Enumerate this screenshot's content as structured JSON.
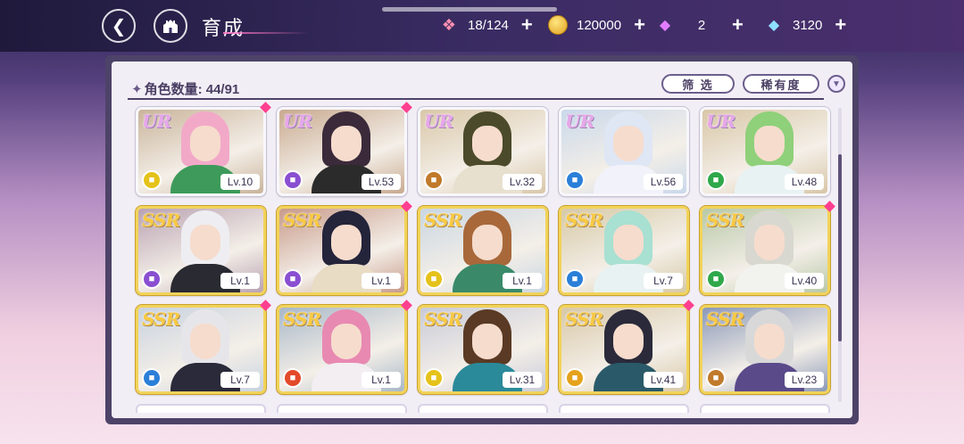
{
  "header": {
    "title": "育成",
    "back_icon": "back-arrow-icon",
    "home_icon": "castle-home-icon"
  },
  "resources": [
    {
      "icon": "candy-icon",
      "value": "18/124"
    },
    {
      "icon": "coin-icon",
      "value": "120000"
    },
    {
      "icon": "pink-diamond-icon",
      "value": "2"
    },
    {
      "icon": "blue-diamond-icon",
      "value": "3120"
    }
  ],
  "panel": {
    "count_label": "角色数量: 44/91",
    "filter_label": "筛 选",
    "rarity_label": "稀有度",
    "sort_icon": "chevron-down-icon"
  },
  "cards": [
    {
      "rarity": "UR",
      "level": "Lv.10",
      "attr_color": "#e5c21a",
      "hair": "#f2a9c8",
      "outfit": "#3d9a5a",
      "bg": "#c9b39a",
      "new": true
    },
    {
      "rarity": "UR",
      "level": "Lv.53",
      "attr_color": "#8a4fd1",
      "hair": "#3a2a3a",
      "outfit": "#2b2b2b",
      "bg": "#c8a98f",
      "new": true
    },
    {
      "rarity": "UR",
      "level": "Lv.32",
      "attr_color": "#c07a2a",
      "hair": "#4b4a2a",
      "outfit": "#e8e0cf",
      "bg": "#d9c7a8",
      "new": false
    },
    {
      "rarity": "UR",
      "level": "Lv.56",
      "attr_color": "#2a7fd8",
      "hair": "#dfe6f4",
      "outfit": "#f2f2fa",
      "bg": "#c9d8ea",
      "new": false
    },
    {
      "rarity": "UR",
      "level": "Lv.48",
      "attr_color": "#2fa84a",
      "hair": "#8fd07a",
      "outfit": "#e8f2f2",
      "bg": "#d8c6a6",
      "new": false
    },
    {
      "rarity": "SSR",
      "level": "Lv.1",
      "attr_color": "#8a4fd1",
      "hair": "#eeeef2",
      "outfit": "#2a2a32",
      "bg": "#b9a2b2",
      "new": false
    },
    {
      "rarity": "SSR",
      "level": "Lv.1",
      "attr_color": "#8a4fd1",
      "hair": "#24243a",
      "outfit": "#e8dcc4",
      "bg": "#c89a8a",
      "new": true
    },
    {
      "rarity": "SSR",
      "level": "Lv.1",
      "attr_color": "#e5c21a",
      "hair": "#a8683a",
      "outfit": "#3a8a6a",
      "bg": "#c9d6e2",
      "new": false
    },
    {
      "rarity": "SSR",
      "level": "Lv.7",
      "attr_color": "#2a7fd8",
      "hair": "#a8e0d2",
      "outfit": "#e8f2f2",
      "bg": "#d6c9a6",
      "new": false
    },
    {
      "rarity": "SSR",
      "level": "Lv.40",
      "attr_color": "#2fa84a",
      "hair": "#d8d8d0",
      "outfit": "#f2f2ee",
      "bg": "#b8c8a8",
      "new": true
    },
    {
      "rarity": "SSR",
      "level": "Lv.7",
      "attr_color": "#2a7fd8",
      "hair": "#e6e6ea",
      "outfit": "#2a2a3a",
      "bg": "#c8d2e0",
      "new": true
    },
    {
      "rarity": "SSR",
      "level": "Lv.1",
      "attr_color": "#e34a2a",
      "hair": "#e889b2",
      "outfit": "#f2eef2",
      "bg": "#a8b8c8",
      "new": true
    },
    {
      "rarity": "SSR",
      "level": "Lv.31",
      "attr_color": "#e5c21a",
      "hair": "#5a3a24",
      "outfit": "#2a8a9a",
      "bg": "#c8cad8",
      "new": false
    },
    {
      "rarity": "SSR",
      "level": "Lv.41",
      "attr_color": "#e5a21a",
      "hair": "#2a2a3a",
      "outfit": "#2a5a6a",
      "bg": "#d8c8a8",
      "new": true
    },
    {
      "rarity": "SSR",
      "level": "Lv.23",
      "attr_color": "#c07a2a",
      "hair": "#d8d8d8",
      "outfit": "#5a4a8a",
      "bg": "#8a98b8",
      "new": false
    }
  ]
}
